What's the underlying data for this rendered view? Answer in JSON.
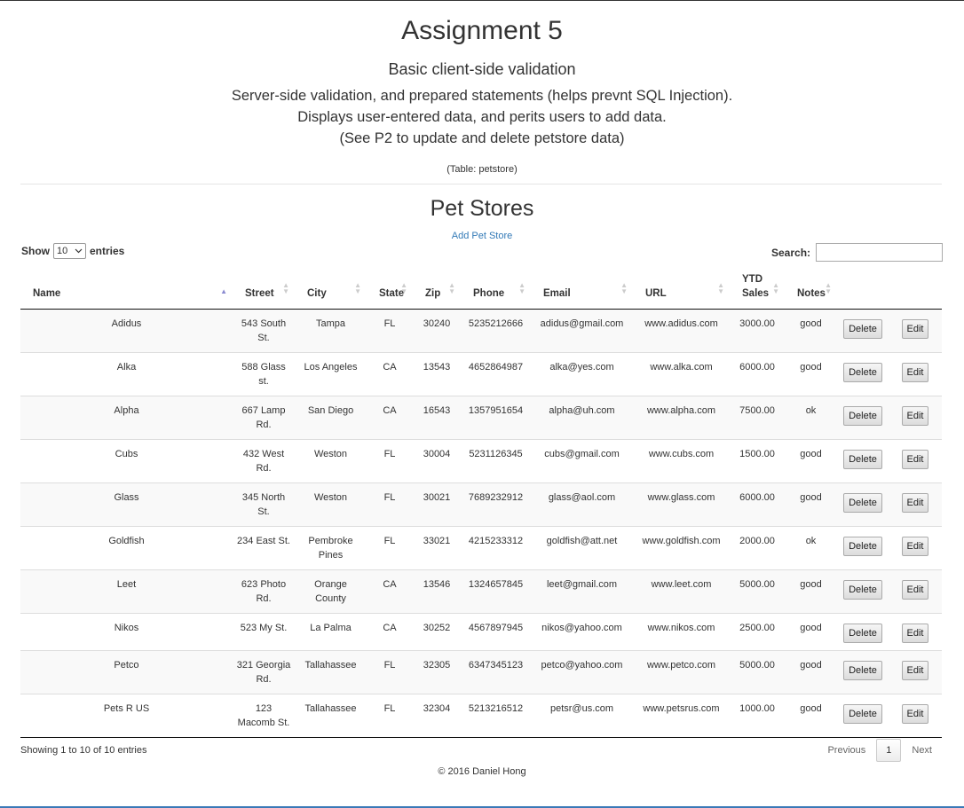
{
  "header": {
    "title": "Assignment 5",
    "subtitle": "Basic client-side validation",
    "desc_line1": "Server-side validation, and prepared statements (helps prevnt SQL Injection).",
    "desc_line2": "Displays user-entered data, and perits users to add data.",
    "desc_line3": "(See P2 to update and delete petstore data)",
    "table_note": "(Table: petstore)"
  },
  "section": {
    "title": "Pet Stores",
    "add_link": "Add Pet Store"
  },
  "controls": {
    "show_label": "Show",
    "entries_value": "10",
    "entries_label": "entries",
    "search_label": "Search:"
  },
  "columns": [
    "Name",
    "Street",
    "City",
    "State",
    "Zip",
    "Phone",
    "Email",
    "URL",
    "YTD Sales",
    "Notes"
  ],
  "rows": [
    {
      "name": "Adidus",
      "street": "543 South St.",
      "city": "Tampa",
      "state": "FL",
      "zip": "30240",
      "phone": "5235212666",
      "email": "adidus@gmail.com",
      "url": "www.adidus.com",
      "sales": "3000.00",
      "notes": "good"
    },
    {
      "name": "Alka",
      "street": "588 Glass st.",
      "city": "Los Angeles",
      "state": "CA",
      "zip": "13543",
      "phone": "4652864987",
      "email": "alka@yes.com",
      "url": "www.alka.com",
      "sales": "6000.00",
      "notes": "good"
    },
    {
      "name": "Alpha",
      "street": "667 Lamp Rd.",
      "city": "San Diego",
      "state": "CA",
      "zip": "16543",
      "phone": "1357951654",
      "email": "alpha@uh.com",
      "url": "www.alpha.com",
      "sales": "7500.00",
      "notes": "ok"
    },
    {
      "name": "Cubs",
      "street": "432 West Rd.",
      "city": "Weston",
      "state": "FL",
      "zip": "30004",
      "phone": "5231126345",
      "email": "cubs@gmail.com",
      "url": "www.cubs.com",
      "sales": "1500.00",
      "notes": "good"
    },
    {
      "name": "Glass",
      "street": "345 North St.",
      "city": "Weston",
      "state": "FL",
      "zip": "30021",
      "phone": "7689232912",
      "email": "glass@aol.com",
      "url": "www.glass.com",
      "sales": "6000.00",
      "notes": "good"
    },
    {
      "name": "Goldfish",
      "street": "234 East St.",
      "city": "Pembroke Pines",
      "state": "FL",
      "zip": "33021",
      "phone": "4215233312",
      "email": "goldfish@att.net",
      "url": "www.goldfish.com",
      "sales": "2000.00",
      "notes": "ok"
    },
    {
      "name": "Leet",
      "street": "623 Photo Rd.",
      "city": "Orange County",
      "state": "CA",
      "zip": "13546",
      "phone": "1324657845",
      "email": "leet@gmail.com",
      "url": "www.leet.com",
      "sales": "5000.00",
      "notes": "good"
    },
    {
      "name": "Nikos",
      "street": "523 My St.",
      "city": "La Palma",
      "state": "CA",
      "zip": "30252",
      "phone": "4567897945",
      "email": "nikos@yahoo.com",
      "url": "www.nikos.com",
      "sales": "2500.00",
      "notes": "good"
    },
    {
      "name": "Petco",
      "street": "321 Georgia Rd.",
      "city": "Tallahassee",
      "state": "FL",
      "zip": "32305",
      "phone": "6347345123",
      "email": "petco@yahoo.com",
      "url": "www.petco.com",
      "sales": "5000.00",
      "notes": "good"
    },
    {
      "name": "Pets R US",
      "street": "123 Macomb St.",
      "city": "Tallahassee",
      "state": "FL",
      "zip": "32304",
      "phone": "5213216512",
      "email": "petsr@us.com",
      "url": "www.petsrus.com",
      "sales": "1000.00",
      "notes": "good"
    }
  ],
  "buttons": {
    "delete": "Delete",
    "edit": "Edit"
  },
  "info": "Showing 1 to 10 of 10 entries",
  "pagination": {
    "previous": "Previous",
    "current": "1",
    "next": "Next"
  },
  "footer": "© 2016 Daniel Hong"
}
